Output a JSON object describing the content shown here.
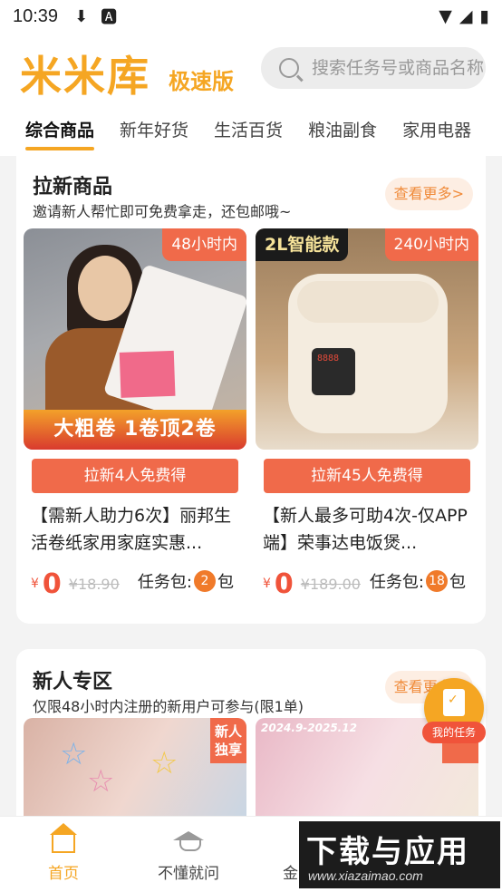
{
  "status_bar": {
    "time": "10:39"
  },
  "header": {
    "logo": "米米库",
    "logo_sub": "极速版",
    "search_placeholder": "搜索任务号或商品名称"
  },
  "tabs": [
    "综合商品",
    "新年好货",
    "生活百货",
    "粮油副食",
    "家用电器"
  ],
  "section1": {
    "title": "拉新商品",
    "subtitle": "邀请新人帮忙即可免费拿走，还包邮哦~",
    "more": "查看更多>",
    "products": [
      {
        "time_badge": "48小时内",
        "image_caption": "大粗卷 1卷顶2卷",
        "claim": "拉新4人免费得",
        "name": "【需新人助力6次】丽邦生活卷纸家用家庭实惠...",
        "yen": "¥",
        "price": "0",
        "orig_price": "¥18.90",
        "task_label": "任务包:",
        "task_count": "2",
        "task_unit": "包"
      },
      {
        "time_badge": "240小时内",
        "image_tag": "2L智能款",
        "claim": "拉新45人免费得",
        "name": "【新人最多可助4次-仅APP端】荣事达电饭煲...",
        "yen": "¥",
        "price": "0",
        "orig_price": "¥189.00",
        "task_label": "任务包:",
        "task_count": "18",
        "task_unit": "包"
      }
    ]
  },
  "section2": {
    "title": "新人专区",
    "subtitle": "仅限48小时内注册的新用户可参与(限1单)",
    "more": "查看更多>",
    "products": [
      {
        "badge": "新人独享"
      },
      {
        "badge": "独享",
        "date_text": "2024.9-2025.12"
      }
    ]
  },
  "float_button": {
    "label": "我的任务"
  },
  "bottom_nav": [
    {
      "label": "首页",
      "active": true
    },
    {
      "label": "不懂就问",
      "active": false
    },
    {
      "label": "金币中心",
      "active": false
    },
    {
      "label": "我的",
      "active": false
    }
  ],
  "watermark": {
    "title": "下载与应用",
    "url": "www.xiazaimao.com"
  },
  "colors": {
    "accent": "#f5a623",
    "promo": "#f06a4a",
    "price": "#f0533a"
  }
}
